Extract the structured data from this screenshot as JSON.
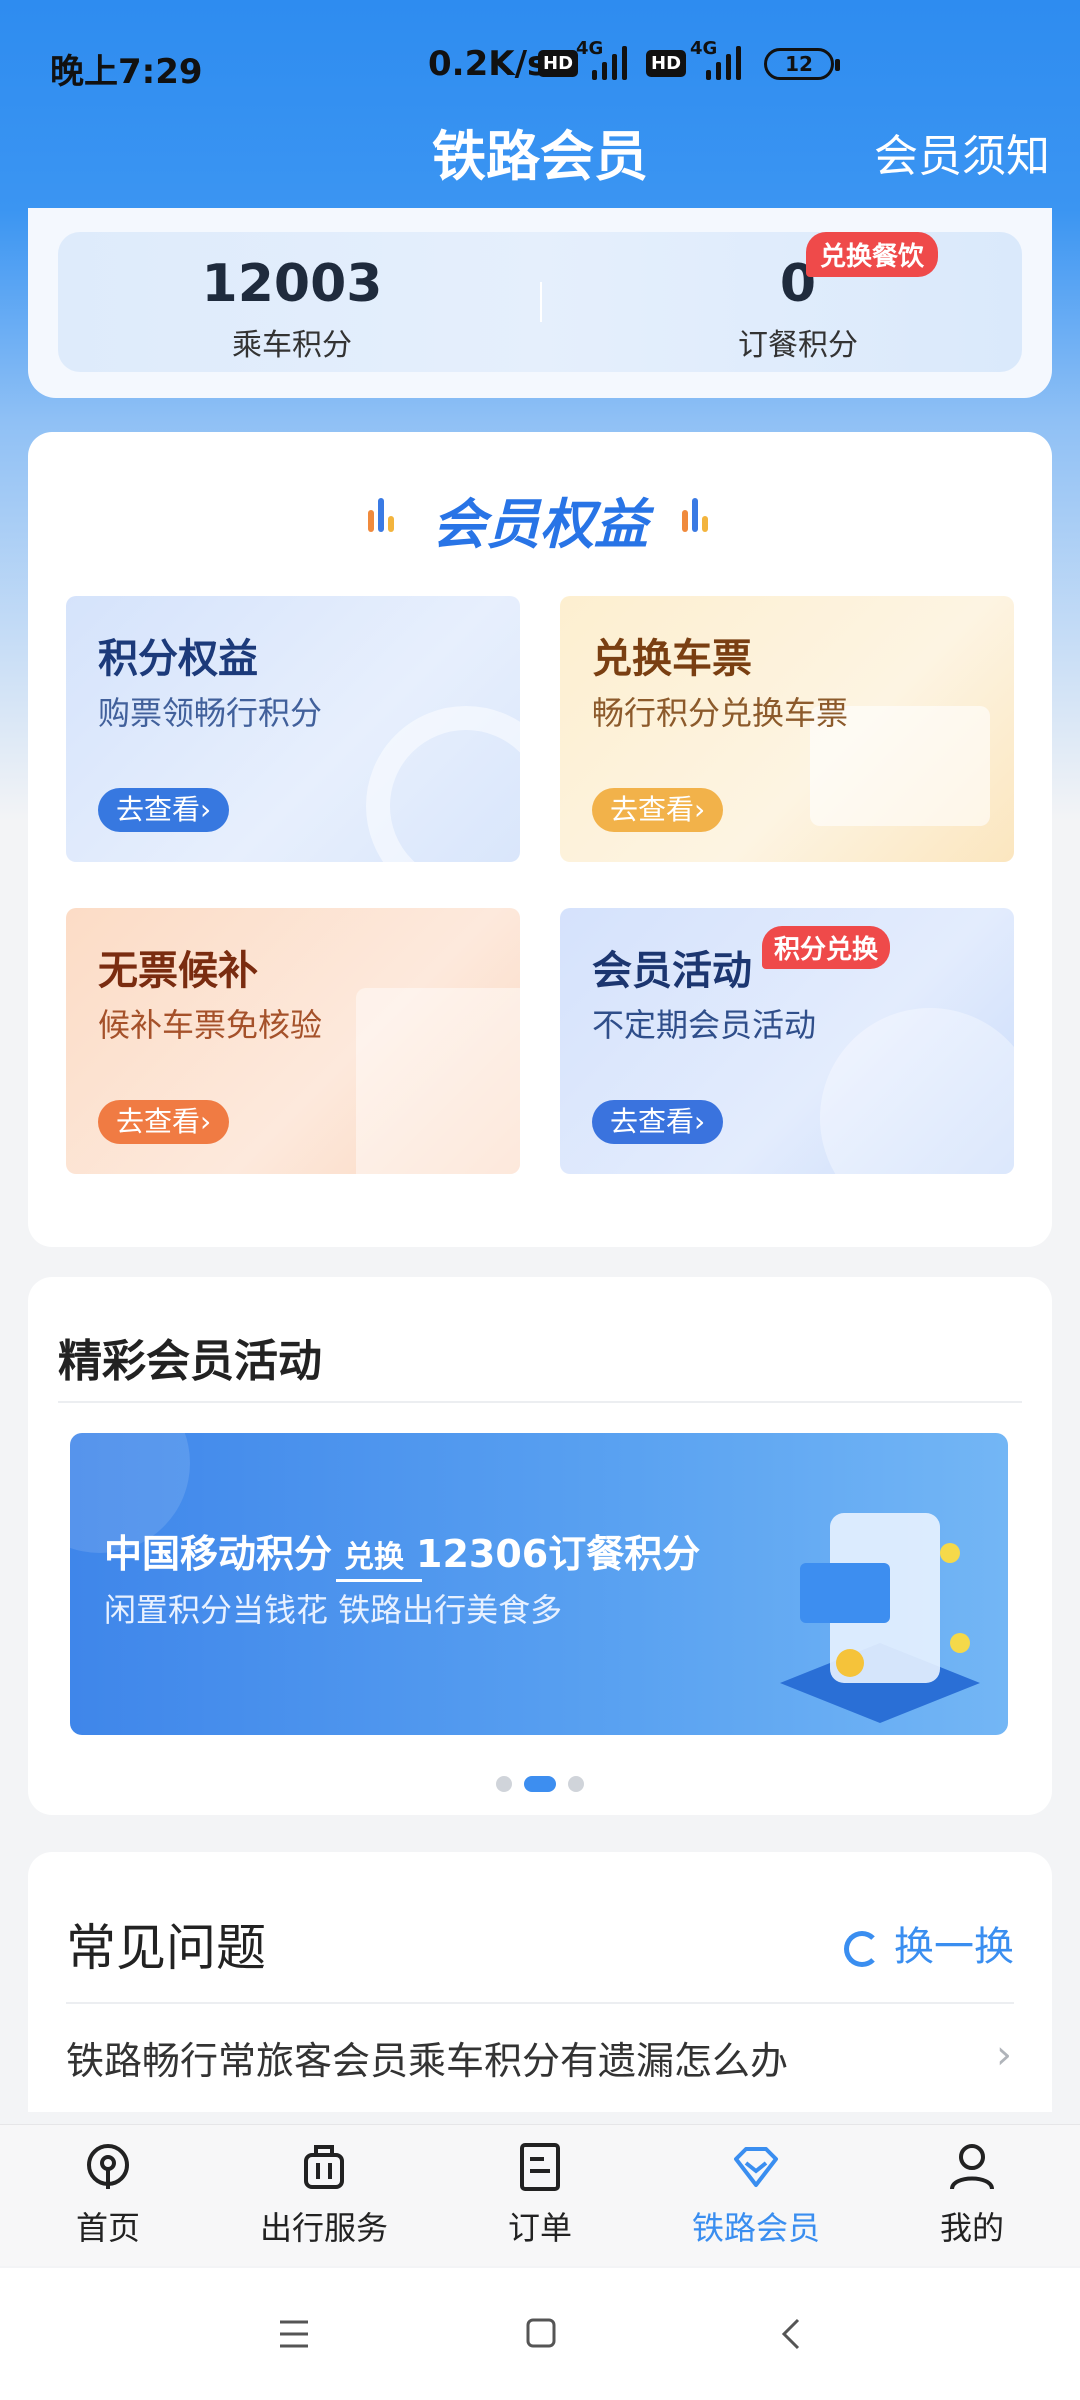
{
  "status_bar": {
    "time": "晚上7:29",
    "net_speed": "0.2K/s",
    "hd1": "HD",
    "net1": "4G",
    "hd2": "HD",
    "net2": "4G",
    "battery": "12"
  },
  "header": {
    "title": "铁路会员",
    "right_link": "会员须知"
  },
  "points": {
    "ride_points_value": "12003",
    "ride_points_label": "乘车积分",
    "meal_points_value": "0",
    "meal_points_label": "订餐积分",
    "meal_badge": "兑换餐饮"
  },
  "benefits": {
    "title": "会员权益",
    "tiles": [
      {
        "title": "积分权益",
        "subtitle": "购票领畅行积分",
        "button": "去查看›"
      },
      {
        "title": "兑换车票",
        "subtitle": "畅行积分兑换车票",
        "button": "去查看›"
      },
      {
        "title": "无票候补",
        "subtitle": "候补车票免核验",
        "button": "去查看›"
      },
      {
        "title": "会员活动",
        "subtitle": "不定期会员活动",
        "button": "去查看›",
        "badge": "积分兑换"
      }
    ]
  },
  "activities": {
    "title": "精彩会员活动",
    "banner": {
      "left_text": "中国移动积分",
      "arrow_text": "兑换",
      "right_text": "12306订餐积分",
      "tagline": "闲置积分当钱花 铁路出行美食多"
    },
    "pager": {
      "count": 3,
      "active_index": 1
    }
  },
  "faq": {
    "title": "常见问题",
    "refresh_label": "换一换",
    "questions": [
      "铁路畅行常旅客会员乘车积分有遗漏怎么办"
    ]
  },
  "tabbar": {
    "tabs": [
      {
        "label": "首页",
        "icon": "train-logo-icon"
      },
      {
        "label": "出行服务",
        "icon": "luggage-icon"
      },
      {
        "label": "订单",
        "icon": "order-doc-icon"
      },
      {
        "label": "铁路会员",
        "icon": "diamond-icon",
        "active": true
      },
      {
        "label": "我的",
        "icon": "person-icon"
      }
    ]
  },
  "colors": {
    "primary_blue": "#2e8cf0",
    "active_tab": "#3a8ef0",
    "badge_red": "#ef4a4a"
  }
}
